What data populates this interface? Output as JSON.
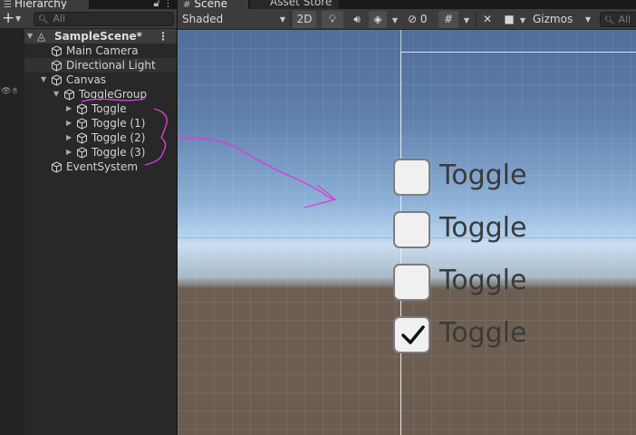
{
  "hierarchy": {
    "tab_label": "Hierarchy",
    "search_placeholder": "All",
    "scene": {
      "name": "SampleScene*"
    },
    "items": [
      {
        "label": "Main Camera",
        "depth": 1,
        "expanded": null
      },
      {
        "label": "Directional Light",
        "depth": 1,
        "expanded": null
      },
      {
        "label": "Canvas",
        "depth": 1,
        "expanded": true
      },
      {
        "label": "ToggleGroup",
        "depth": 2,
        "expanded": true
      },
      {
        "label": "Toggle",
        "depth": 3,
        "expanded": false
      },
      {
        "label": "Toggle (1)",
        "depth": 3,
        "expanded": false
      },
      {
        "label": "Toggle (2)",
        "depth": 3,
        "expanded": false
      },
      {
        "label": "Toggle (3)",
        "depth": 3,
        "expanded": false
      },
      {
        "label": "EventSystem",
        "depth": 1,
        "expanded": null
      }
    ]
  },
  "scene_view": {
    "tabs": [
      {
        "label": "Scene",
        "active": true
      },
      {
        "label": "Asset Store",
        "active": false
      }
    ],
    "toolbar": {
      "draw_mode": "Shaded",
      "mode_2d": "2D",
      "hidden_count": "0",
      "gizmos": "Gizmos",
      "search_placeholder": "All"
    },
    "toggles": [
      {
        "label": "Toggle",
        "checked": false
      },
      {
        "label": "Toggle",
        "checked": false
      },
      {
        "label": "Toggle",
        "checked": false
      },
      {
        "label": "Toggle",
        "checked": true
      }
    ]
  },
  "colors": {
    "accent": "#3a79bb",
    "annotation": "#d63fd6",
    "panel_bg": "#282828",
    "toolbar_bg": "#3c3c3c"
  }
}
